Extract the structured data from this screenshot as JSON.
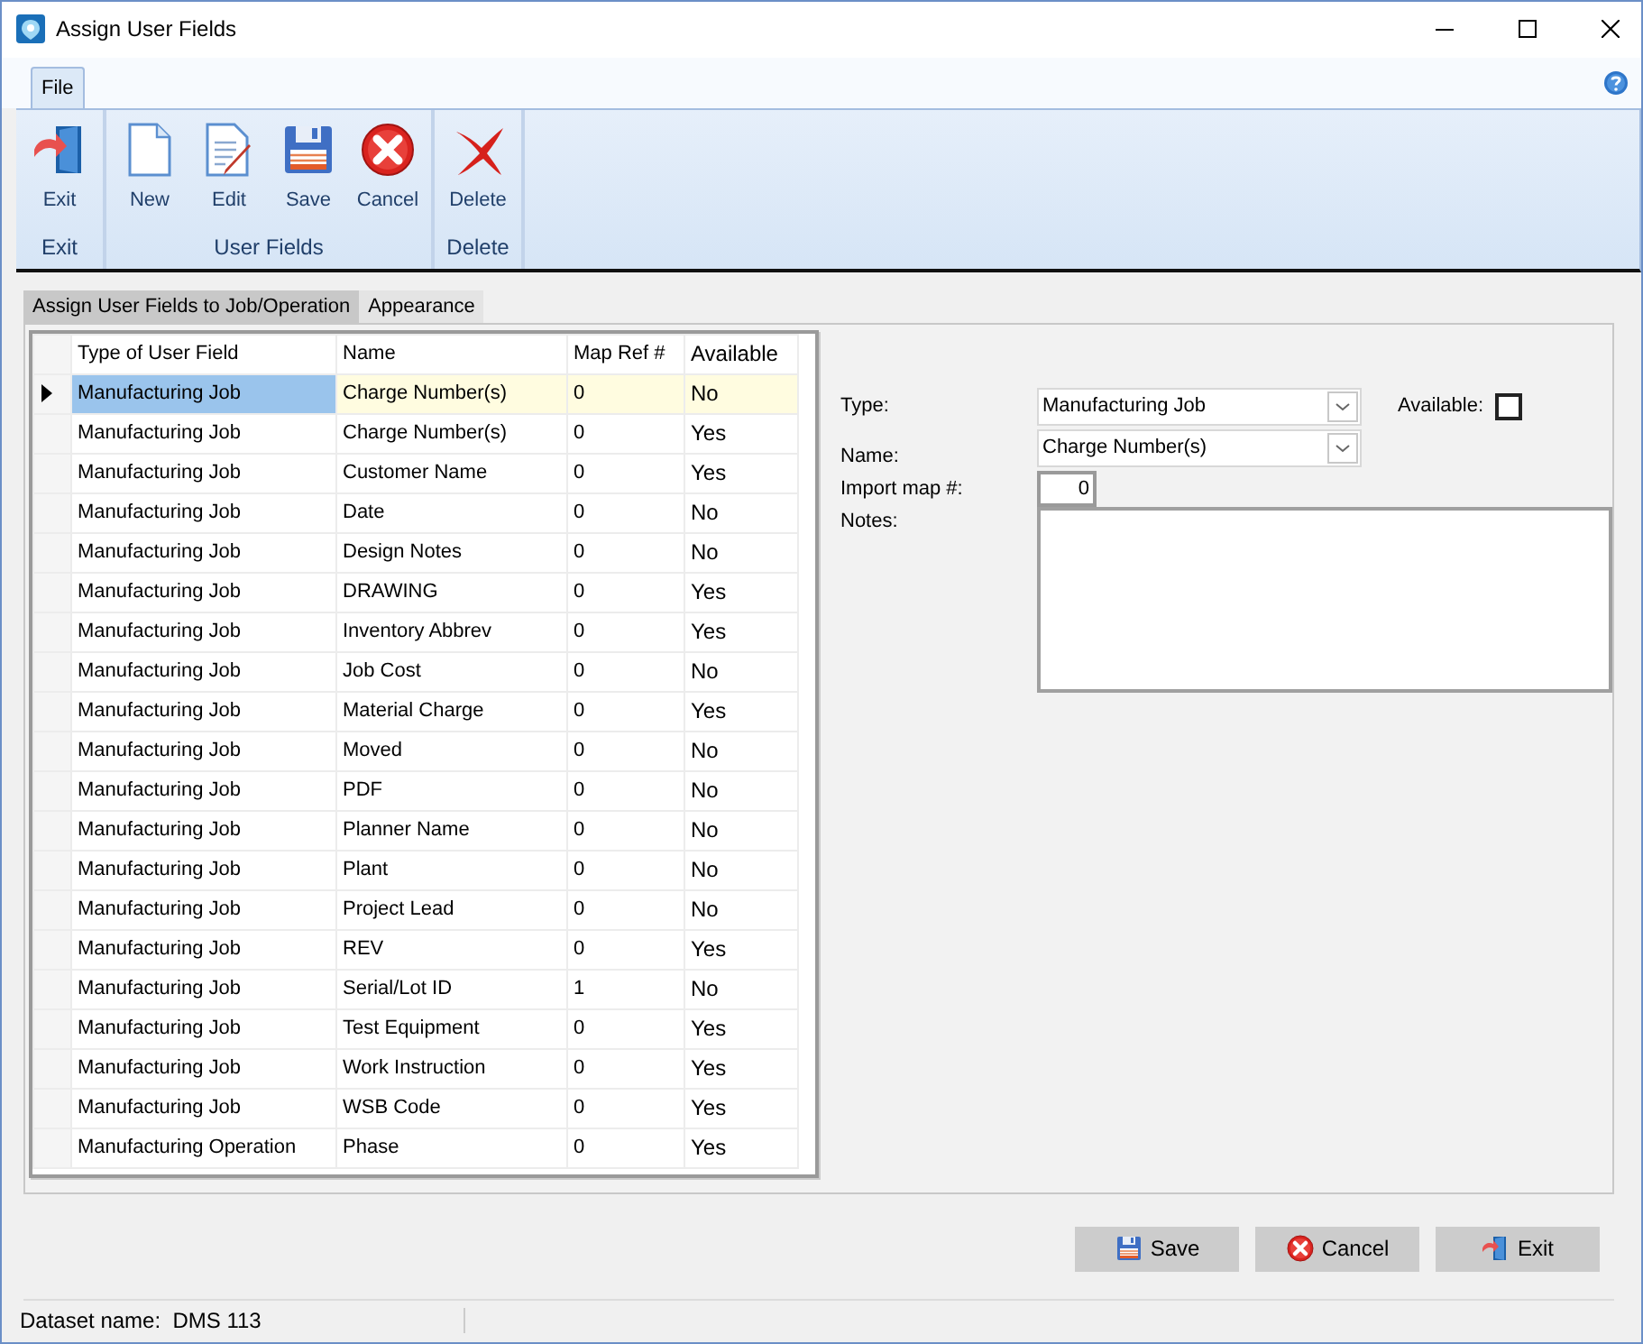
{
  "window": {
    "title": "Assign User Fields"
  },
  "ribbon": {
    "tabs": [
      {
        "label": "File",
        "selected": true
      }
    ],
    "groups": [
      {
        "label": "Exit",
        "buttons": [
          {
            "label": "Exit",
            "kind": "exit"
          }
        ]
      },
      {
        "label": "User Fields",
        "buttons": [
          {
            "label": "New",
            "kind": "new"
          },
          {
            "label": "Edit",
            "kind": "edit"
          },
          {
            "label": "Save",
            "kind": "save"
          },
          {
            "label": "Cancel",
            "kind": "cancel"
          }
        ]
      },
      {
        "label": "Delete",
        "buttons": [
          {
            "label": "Delete",
            "kind": "delete"
          }
        ]
      }
    ]
  },
  "tabs": [
    {
      "label": "Assign User Fields to Job/Operation",
      "selected": true
    },
    {
      "label": "Appearance",
      "selected": false
    }
  ],
  "table": {
    "columns": [
      "Type of User Field",
      "Name",
      "Map Ref #",
      "Available"
    ],
    "rows": [
      {
        "cells": [
          "Manufacturing Job",
          "Charge Number(s)",
          "0",
          "No"
        ],
        "selected": true
      },
      {
        "cells": [
          "Manufacturing Job",
          "Charge Number(s)",
          "0",
          "Yes"
        ],
        "selected": false
      },
      {
        "cells": [
          "Manufacturing Job",
          "Customer Name",
          "0",
          "Yes"
        ],
        "selected": false
      },
      {
        "cells": [
          "Manufacturing Job",
          "Date",
          "0",
          "No"
        ],
        "selected": false
      },
      {
        "cells": [
          "Manufacturing Job",
          "Design Notes",
          "0",
          "No"
        ],
        "selected": false
      },
      {
        "cells": [
          "Manufacturing Job",
          "DRAWING",
          "0",
          "Yes"
        ],
        "selected": false
      },
      {
        "cells": [
          "Manufacturing Job",
          "Inventory Abbrev",
          "0",
          "Yes"
        ],
        "selected": false
      },
      {
        "cells": [
          "Manufacturing Job",
          "Job Cost",
          "0",
          "No"
        ],
        "selected": false
      },
      {
        "cells": [
          "Manufacturing Job",
          "Material Charge",
          "0",
          "Yes"
        ],
        "selected": false
      },
      {
        "cells": [
          "Manufacturing Job",
          "Moved",
          "0",
          "No"
        ],
        "selected": false
      },
      {
        "cells": [
          "Manufacturing Job",
          "PDF",
          "0",
          "No"
        ],
        "selected": false
      },
      {
        "cells": [
          "Manufacturing Job",
          "Planner Name",
          "0",
          "No"
        ],
        "selected": false
      },
      {
        "cells": [
          "Manufacturing Job",
          "Plant",
          "0",
          "No"
        ],
        "selected": false
      },
      {
        "cells": [
          "Manufacturing Job",
          "Project Lead",
          "0",
          "No"
        ],
        "selected": false
      },
      {
        "cells": [
          "Manufacturing Job",
          "REV",
          "0",
          "Yes"
        ],
        "selected": false
      },
      {
        "cells": [
          "Manufacturing Job",
          "Serial/Lot ID",
          "1",
          "No"
        ],
        "selected": false
      },
      {
        "cells": [
          "Manufacturing Job",
          "Test Equipment",
          "0",
          "Yes"
        ],
        "selected": false
      },
      {
        "cells": [
          "Manufacturing Job",
          "Work Instruction",
          "0",
          "Yes"
        ],
        "selected": false
      },
      {
        "cells": [
          "Manufacturing Job",
          "WSB Code",
          "0",
          "Yes"
        ],
        "selected": false
      },
      {
        "cells": [
          "Manufacturing Operation",
          "Phase",
          "0",
          "Yes"
        ],
        "selected": false
      }
    ]
  },
  "form": {
    "type": {
      "label": "Type:",
      "value": "Manufacturing Job"
    },
    "available": {
      "label": "Available:",
      "checked": false
    },
    "name": {
      "label": "Name:",
      "value": "Charge Number(s)"
    },
    "import_map": {
      "label": "Import map #:",
      "value": "0"
    },
    "notes": {
      "label": "Notes:"
    }
  },
  "buttons": [
    {
      "label": "Save",
      "kind": "save"
    },
    {
      "label": "Cancel",
      "kind": "cancel"
    },
    {
      "label": "Exit",
      "kind": "exit"
    }
  ],
  "status_bar": {
    "text": "Dataset name:  DMS 113"
  }
}
